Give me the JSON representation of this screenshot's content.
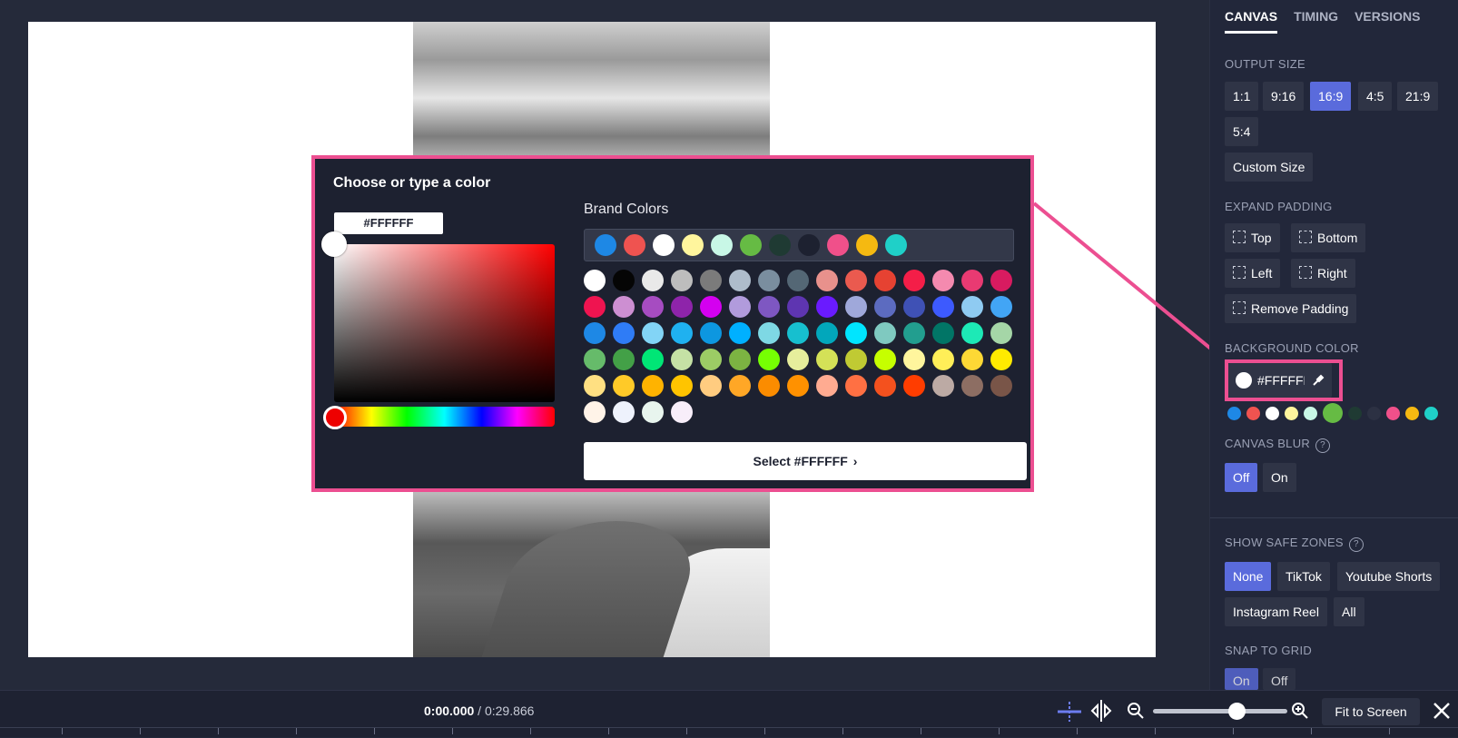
{
  "popup": {
    "title": "Choose or type a color",
    "hex_value": "#FFFFFF",
    "brand_label": "Brand Colors",
    "brand_colors": [
      "#1e88e5",
      "#ef5350",
      "#ffffff",
      "#fff59d",
      "#c8f7e6",
      "#66bb44",
      "#1f3a33",
      "#1d2130",
      "#f0508a",
      "#f5b911",
      "#1fd0c8"
    ],
    "palette": [
      "#ffffff",
      "#050505",
      "#e9e9e9",
      "#bdbdbd",
      "#7b7b7b",
      "#aebccb",
      "#7a8e9f",
      "#546775",
      "#e8918c",
      "#ea5a4f",
      "#e64232",
      "#f41e48",
      "#f48aaf",
      "#e93a72",
      "#d81b60",
      "#ef1450",
      "#cd8fd2",
      "#a64cc1",
      "#8e24aa",
      "#d400f0",
      "#b19bdc",
      "#7e57c2",
      "#5e35b1",
      "#6a1bff",
      "#9fa8da",
      "#5c6bc0",
      "#3f51b5",
      "#3d5afe",
      "#8fcbf2",
      "#42a5f5",
      "#1e88e5",
      "#2f7cf6",
      "#82d4f6",
      "#1fb1f0",
      "#0d97e0",
      "#00b0ff",
      "#7ed8e4",
      "#17bfcf",
      "#02a7bb",
      "#00e5ff",
      "#7fc9c0",
      "#229e8f",
      "#017566",
      "#1de9b6",
      "#a5d6a7",
      "#66bb6a",
      "#43a047",
      "#00e676",
      "#c5e1a5",
      "#9ccc65",
      "#7cb342",
      "#76ff03",
      "#e6ee9c",
      "#d4e157",
      "#c0ca33",
      "#c6ff00",
      "#fff59d",
      "#ffee58",
      "#fdd835",
      "#ffea00",
      "#ffe082",
      "#ffca28",
      "#ffb300",
      "#ffc400",
      "#ffcc80",
      "#ffa726",
      "#fb8c00",
      "#ff9100",
      "#ffab91",
      "#ff7043",
      "#f4511e",
      "#ff3d00",
      "#bcaaa4",
      "#8d6e63",
      "#795548",
      "#fff3e8",
      "#eef2fc",
      "#e8f5ee",
      "#f8eefa"
    ],
    "select_label": "Select #FFFFFF",
    "select_chevron": "›"
  },
  "panel": {
    "tabs": [
      "CANVAS",
      "TIMING",
      "VERSIONS"
    ],
    "output_size_label": "OUTPUT SIZE",
    "sizes": [
      "1:1",
      "9:16",
      "16:9",
      "4:5",
      "21:9",
      "5:4"
    ],
    "custom_size": "Custom Size",
    "expand_padding_label": "EXPAND PADDING",
    "padding": {
      "top": "Top",
      "bottom": "Bottom",
      "left": "Left",
      "right": "Right",
      "remove": "Remove Padding"
    },
    "background_color_label": "BACKGROUND COLOR",
    "bg_hex": "#FFFFFF",
    "bg_swatches": [
      "#1e88e5",
      "#ef5350",
      "#ffffff",
      "#fff59d",
      "#c8f7e6",
      "#66bb44",
      "#1f3a33",
      "#2c3143",
      "#f0508a",
      "#f5b911",
      "#1fd0c8"
    ],
    "canvas_blur_label": "CANVAS BLUR",
    "blur": {
      "off": "Off",
      "on": "On"
    },
    "safe_zones_label": "SHOW SAFE ZONES",
    "safe_zones": {
      "none": "None",
      "tiktok": "TikTok",
      "shorts": "Youtube Shorts",
      "reel": "Instagram Reel",
      "all": "All"
    },
    "snap_label": "SNAP TO GRID",
    "snap": {
      "on": "On",
      "off": "Off"
    }
  },
  "timeline": {
    "current": "0:00.000",
    "separator": " / ",
    "total": "0:29.866",
    "fit_label": "Fit to Screen"
  },
  "colors": {
    "accent": "#5a6bdc",
    "highlight": "#ec4f91"
  }
}
